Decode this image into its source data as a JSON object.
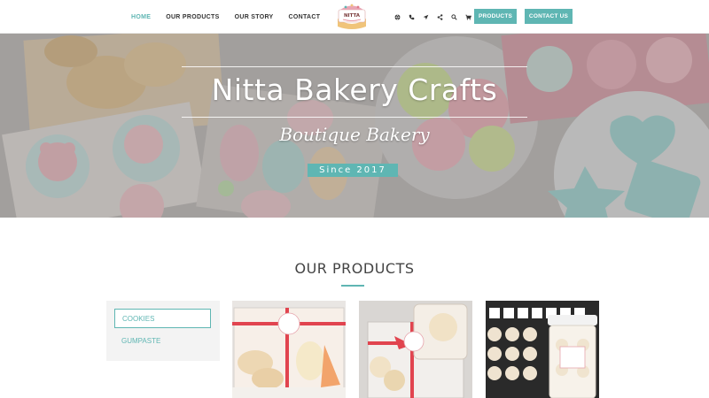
{
  "nav": {
    "links": [
      "HOME",
      "OUR PRODUCTS",
      "OUR STORY",
      "CONTACT"
    ],
    "logo_text": "NITTA",
    "icons": [
      "globe-icon",
      "phone-icon",
      "location-arrow-icon",
      "share-icon",
      "search-icon",
      "cart-icon"
    ],
    "buttons": {
      "products": "PRODUCTS",
      "contact": "CONTACT US"
    }
  },
  "hero": {
    "title": "Nitta Bakery Crafts",
    "subtitle": "Boutique Bakery",
    "since": "Since 2017"
  },
  "products": {
    "heading": "OUR PRODUCTS",
    "filters": [
      "COOKIES",
      "GUMPASTE"
    ],
    "cards": [
      {
        "name": "product-card-cookie-box"
      },
      {
        "name": "product-card-cookie-gift-box"
      },
      {
        "name": "product-card-cookie-jar"
      }
    ]
  },
  "colors": {
    "accent": "#5fb6b3",
    "text": "#333333",
    "panel": "#f3f3f3"
  }
}
